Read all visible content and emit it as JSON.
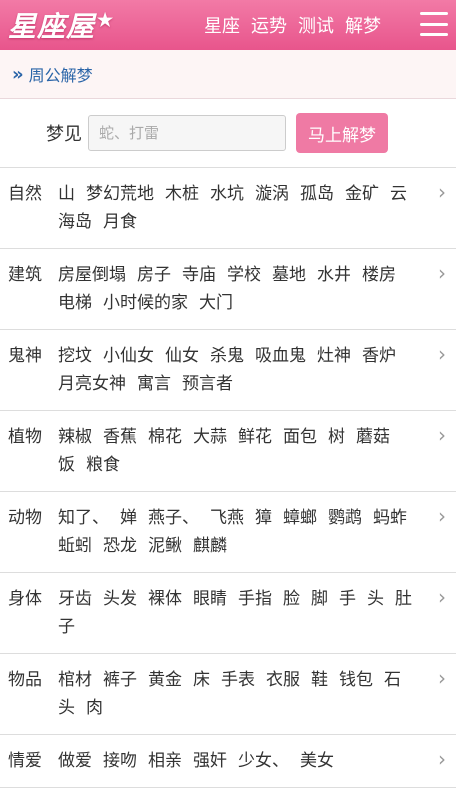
{
  "header": {
    "logo": "星座屋",
    "nav": [
      "星座",
      "运势",
      "测试",
      "解梦"
    ]
  },
  "breadcrumb": {
    "label": "周公解梦"
  },
  "search": {
    "label": "梦见",
    "placeholder": "蛇、打雷",
    "button": "马上解梦"
  },
  "categories": [
    {
      "name": "自然",
      "items": [
        "山",
        "梦幻荒地",
        "木桩",
        "水坑",
        "漩涡",
        "孤岛",
        "金矿",
        "云",
        "海岛",
        "月食"
      ]
    },
    {
      "name": "建筑",
      "items": [
        "房屋倒塌",
        "房子",
        "寺庙",
        "学校",
        "墓地",
        "水井",
        "楼房",
        "电梯",
        "小时候的家",
        "大门"
      ]
    },
    {
      "name": "鬼神",
      "items": [
        "挖坟",
        "小仙女",
        "仙女",
        "杀鬼",
        "吸血鬼",
        "灶神",
        "香炉",
        "月亮女神",
        "寓言",
        "预言者"
      ]
    },
    {
      "name": "植物",
      "items": [
        "辣椒",
        "香蕉",
        "棉花",
        "大蒜",
        "鲜花",
        "面包",
        "树",
        "蘑菇",
        "饭",
        "粮食"
      ]
    },
    {
      "name": "动物",
      "items": [
        "知了、",
        "婵",
        "燕子、",
        "飞燕",
        "獐",
        "蟑螂",
        "鹦鹉",
        "蚂蚱",
        "蚯蚓",
        "恐龙",
        "泥鳅",
        "麒麟"
      ]
    },
    {
      "name": "身体",
      "items": [
        "牙齿",
        "头发",
        "裸体",
        "眼睛",
        "手指",
        "脸",
        "脚",
        "手",
        "头",
        "肚子"
      ]
    },
    {
      "name": "物品",
      "items": [
        "棺材",
        "裤子",
        "黄金",
        "床",
        "手表",
        "衣服",
        "鞋",
        "钱包",
        "石头",
        "肉"
      ]
    },
    {
      "name": "情爱",
      "items": [
        "做爱",
        "接吻",
        "相亲",
        "强奸",
        "少女、",
        "美女"
      ]
    }
  ]
}
